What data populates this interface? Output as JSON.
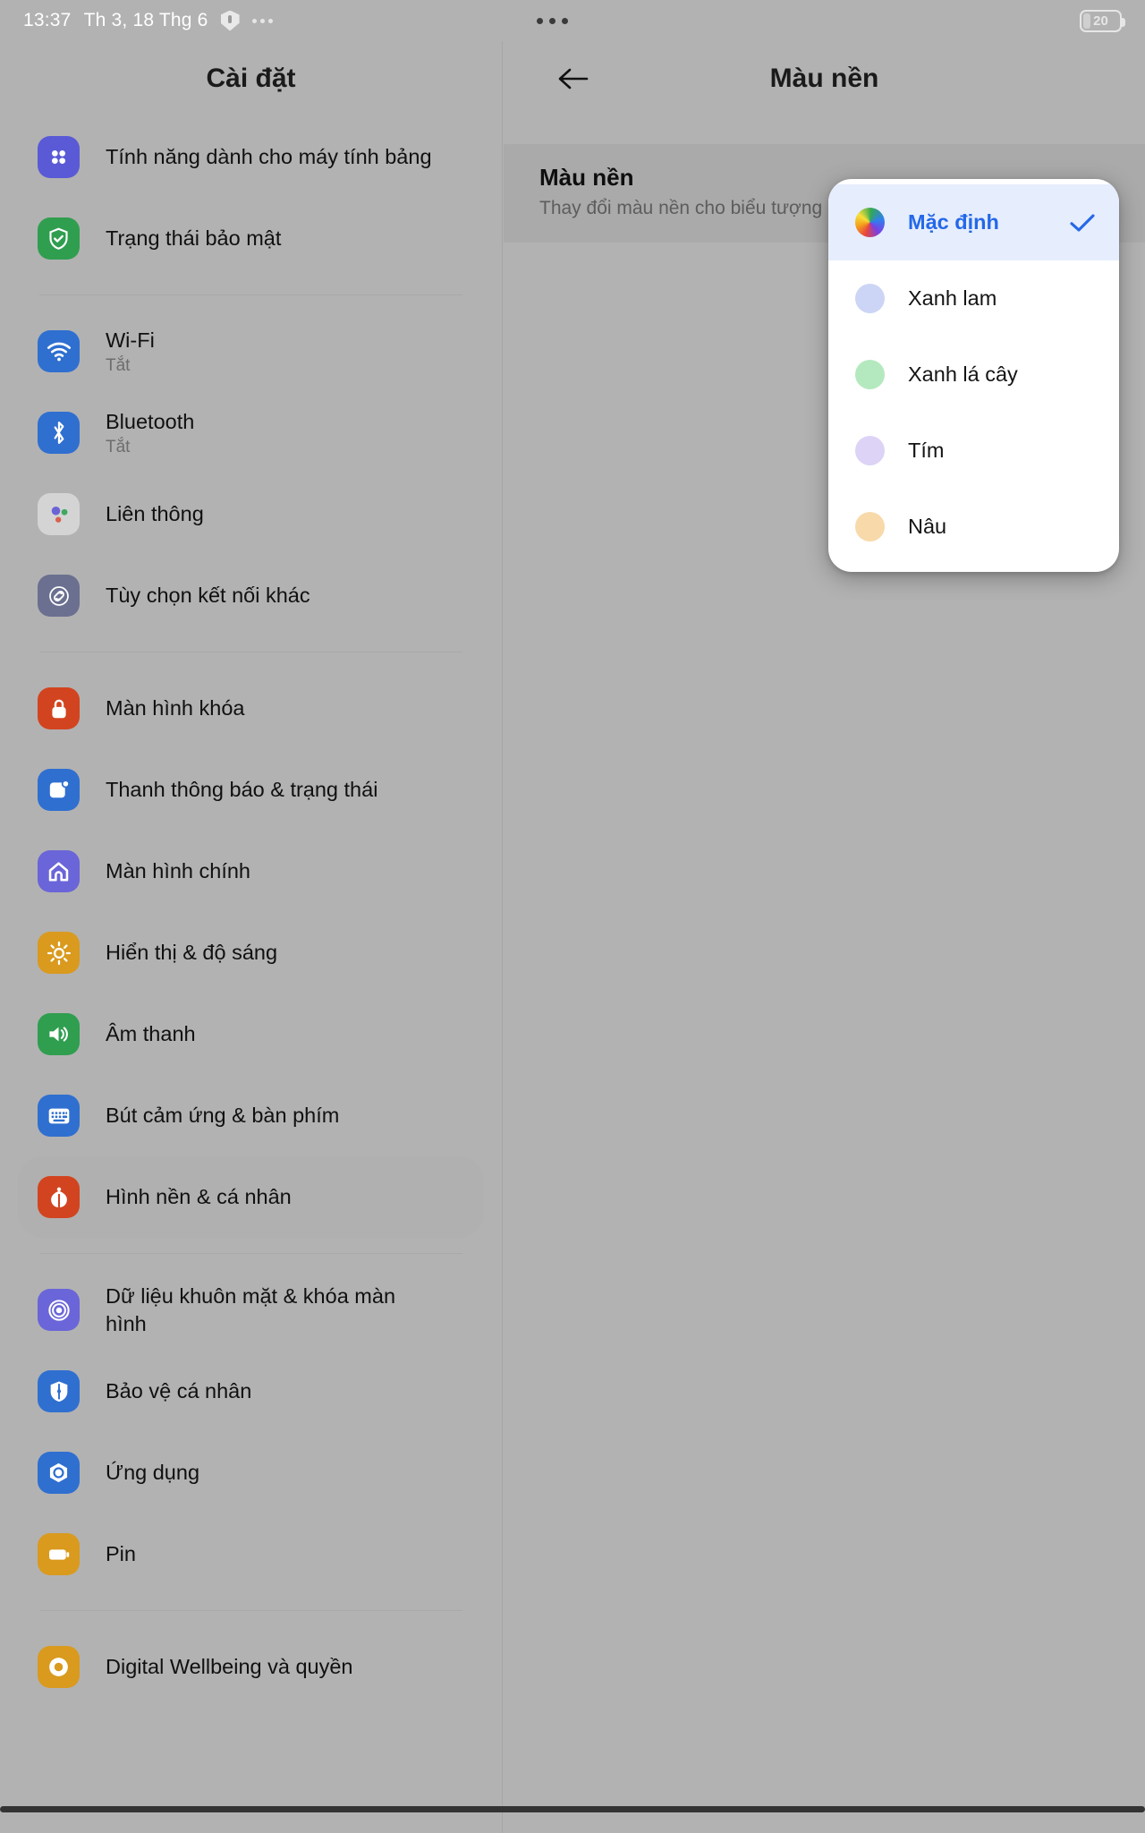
{
  "statusbar": {
    "time": "13:37",
    "date": "Th 3, 18 Thg 6",
    "shield_icon": "shield-icon",
    "overflow_icon": "more-dots-icon",
    "battery_level": "20"
  },
  "left_pane": {
    "title": "Cài đặt",
    "sections": [
      {
        "items": [
          {
            "label": "Tính năng dành cho máy tính bảng",
            "sub": "",
            "icon": "tablet-features-icon",
            "icon_color": "#5a5ad6",
            "selected": false
          },
          {
            "label": "Trạng thái bảo mật",
            "sub": "",
            "icon": "security-shield-icon",
            "icon_color": "#2f9e4f",
            "selected": false
          }
        ]
      },
      {
        "items": [
          {
            "label": "Wi-Fi",
            "sub": "Tắt",
            "icon": "wifi-icon",
            "icon_color": "#2f6fd0",
            "selected": false
          },
          {
            "label": "Bluetooth",
            "sub": "Tắt",
            "icon": "bluetooth-icon",
            "icon_color": "#2f6fd0",
            "selected": false
          },
          {
            "label": "Liên thông",
            "sub": "",
            "icon": "nearby-share-icon",
            "icon_color": "#d4d4d4",
            "selected": false
          },
          {
            "label": "Tùy chọn kết nối khác",
            "sub": "",
            "icon": "link-connection-icon",
            "icon_color": "#6b7090",
            "selected": false
          }
        ]
      },
      {
        "items": [
          {
            "label": "Màn hình khóa",
            "sub": "",
            "icon": "lock-icon",
            "icon_color": "#d2441f",
            "selected": false
          },
          {
            "label": "Thanh thông báo & trạng thái",
            "sub": "",
            "icon": "notification-bar-icon",
            "icon_color": "#2f6fd0",
            "selected": false
          },
          {
            "label": "Màn hình chính",
            "sub": "",
            "icon": "home-icon",
            "icon_color": "#6a65d8",
            "selected": false
          },
          {
            "label": "Hiển thị & độ sáng",
            "sub": "",
            "icon": "brightness-icon",
            "icon_color": "#d99a1e",
            "selected": false
          },
          {
            "label": "Âm thanh",
            "sub": "",
            "icon": "sound-icon",
            "icon_color": "#2f9e4f",
            "selected": false
          },
          {
            "label": "Bút cảm ứng & bàn phím",
            "sub": "",
            "icon": "keyboard-icon",
            "icon_color": "#2f6fd0",
            "selected": false
          },
          {
            "label": "Hình nền & cá nhân",
            "sub": "",
            "icon": "wallpaper-icon",
            "icon_color": "#d2441f",
            "selected": true
          }
        ]
      },
      {
        "items": [
          {
            "label": "Dữ liệu khuôn mặt & khóa màn hình",
            "sub": "",
            "icon": "face-unlock-icon",
            "icon_color": "#6a65d8",
            "selected": false
          },
          {
            "label": "Bảo vệ cá nhân",
            "sub": "",
            "icon": "personal-protection-icon",
            "icon_color": "#2f6fd0",
            "selected": false
          },
          {
            "label": "Ứng dụng",
            "sub": "",
            "icon": "apps-icon",
            "icon_color": "#2f6fd0",
            "selected": false
          },
          {
            "label": "Pin",
            "sub": "",
            "icon": "battery-icon",
            "icon_color": "#d99a1e",
            "selected": false
          }
        ]
      },
      {
        "items": [
          {
            "label": "Digital Wellbeing và quyền",
            "sub": "",
            "icon": "wellbeing-icon",
            "icon_color": "#d99a1e",
            "selected": false
          }
        ]
      }
    ]
  },
  "right_pane": {
    "back_icon": "back-arrow-icon",
    "title": "Màu nền",
    "content": {
      "title": "Màu nền",
      "subtitle": "Thay đổi màu nền cho biểu tượng"
    }
  },
  "dropdown": {
    "items": [
      {
        "label": "Mặc định",
        "swatch": "rainbow",
        "selected": true
      },
      {
        "label": "Xanh lam",
        "swatch": "#ccd5f5",
        "selected": false
      },
      {
        "label": "Xanh lá cây",
        "swatch": "#b4e9bf",
        "selected": false
      },
      {
        "label": "Tím",
        "swatch": "#dcd3f6",
        "selected": false
      },
      {
        "label": "Nâu",
        "swatch": "#f8d9aa",
        "selected": false
      }
    ],
    "accent_color": "#2468e8",
    "selected_row_bg": "#e6edfd",
    "check_icon": "checkmark-icon"
  }
}
